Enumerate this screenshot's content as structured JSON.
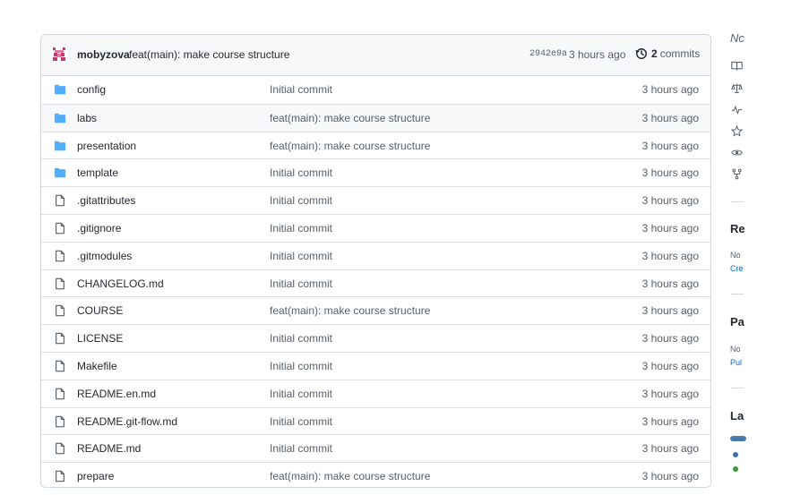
{
  "commit_header": {
    "author": "mobyzova",
    "message": "feat(main): make course structure",
    "sha": "2942e9a",
    "time": "3 hours ago",
    "commits_count": "2",
    "commits_word": "commits"
  },
  "files": [
    {
      "name": "config",
      "type": "folder",
      "commit": "Initial commit",
      "age": "3 hours ago"
    },
    {
      "name": "labs",
      "type": "folder",
      "commit": "feat(main): make course structure",
      "age": "3 hours ago"
    },
    {
      "name": "presentation",
      "type": "folder",
      "commit": "feat(main): make course structure",
      "age": "3 hours ago"
    },
    {
      "name": "template",
      "type": "folder",
      "commit": "Initial commit",
      "age": "3 hours ago"
    },
    {
      "name": ".gitattributes",
      "type": "file",
      "commit": "Initial commit",
      "age": "3 hours ago"
    },
    {
      "name": ".gitignore",
      "type": "file",
      "commit": "Initial commit",
      "age": "3 hours ago"
    },
    {
      "name": ".gitmodules",
      "type": "file",
      "commit": "Initial commit",
      "age": "3 hours ago"
    },
    {
      "name": "CHANGELOG.md",
      "type": "file",
      "commit": "Initial commit",
      "age": "3 hours ago"
    },
    {
      "name": "COURSE",
      "type": "file",
      "commit": "feat(main): make course structure",
      "age": "3 hours ago"
    },
    {
      "name": "LICENSE",
      "type": "file",
      "commit": "Initial commit",
      "age": "3 hours ago"
    },
    {
      "name": "Makefile",
      "type": "file",
      "commit": "Initial commit",
      "age": "3 hours ago"
    },
    {
      "name": "README.en.md",
      "type": "file",
      "commit": "Initial commit",
      "age": "3 hours ago"
    },
    {
      "name": "README.git-flow.md",
      "type": "file",
      "commit": "Initial commit",
      "age": "3 hours ago"
    },
    {
      "name": "README.md",
      "type": "file",
      "commit": "Initial commit",
      "age": "3 hours ago"
    },
    {
      "name": "prepare",
      "type": "file",
      "commit": "feat(main): make course structure",
      "age": "3 hours ago"
    }
  ],
  "sidebar": {
    "about_partial": "Nc",
    "icons": [
      "book-icon",
      "law-icon",
      "pulse-icon",
      "star-icon",
      "eye-icon",
      "fork-icon"
    ],
    "releases_heading": "Re",
    "releases_line1": "No",
    "releases_link": "Cre",
    "packages_heading": "Pa",
    "packages_line1": "No",
    "packages_link": "Pul",
    "languages_heading": "La"
  },
  "colors": {
    "folder": "#54aeff",
    "link": "#0969da",
    "lang_primary": "#4a79b3",
    "lang_secondary": "#3a9b3a"
  }
}
